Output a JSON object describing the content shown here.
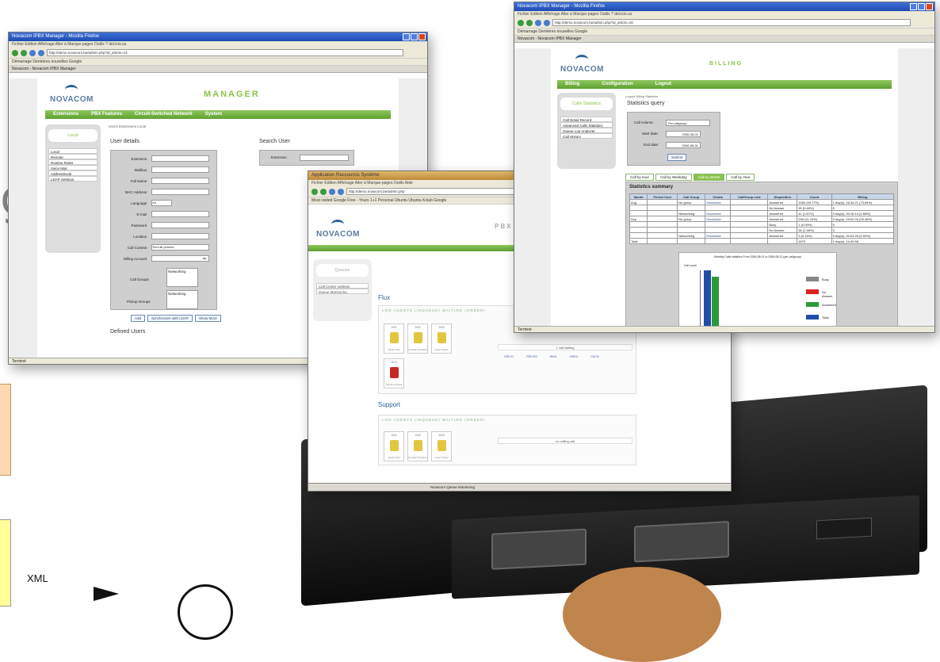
{
  "background": {
    "letter_left": "g",
    "xml_label": "XML"
  },
  "manager": {
    "title": "Novacom IPBX Manager - Mozilla Firefox",
    "menu": "Fichier  Edition  Affichage  Aller à  Marque-pages  Outils  ?  del.icio.us",
    "url": "http://demo.novacom.be/admin.php?id_article=13",
    "bookmarks": "Démarrage  Dernières nouvelles  Google",
    "tab": "Novacom - Novacom IPBX Manager",
    "logo": "NOVACOM",
    "app_title": "MANAGER",
    "nav": [
      "Extensions",
      "PBX Features",
      "Circuit-Switched Network",
      "System"
    ],
    "sidebar_header": "Local",
    "sidebar_items": [
      "Local",
      "Remote",
      "Routing Rules",
      "Voice Mail",
      "Addressbook",
      "LDAP Settings"
    ],
    "breadcrumb": "Users  Extensions  Local",
    "user_details_title": "User details",
    "fields": [
      "Extension",
      "Mailbox",
      "Full Name",
      "MAC Address",
      "Language",
      "E-mail",
      "Password",
      "Location",
      "Call Context",
      "Billing Account"
    ],
    "language_value": "en",
    "call_context_value": "Sort-all phones",
    "billing_account_value": "sip",
    "call_groups_label": "Call Groups",
    "call_groups_value": "Networking",
    "pickup_groups_label": "Pickup Groups",
    "pickup_groups_value": "Networking",
    "buttons": [
      "Add",
      "Synchronize with LDAP",
      "Show More"
    ],
    "search_title": "Search User",
    "search_field": "Extension",
    "defined_users": "Defined Users",
    "status": "Terminé"
  },
  "billing": {
    "title": "Novacom IPBX Manager - Mozilla Firefox",
    "menu": "Fichier  Edition  Affichage  Aller à  Marque-pages  Outils  ?  del.icio.us",
    "url": "http://demo.novacom.be/admin.php?id_article=18",
    "bookmarks": "Démarrage  Dernières nouvelles  Google",
    "tab": "Novacom - Novacom IPBX Manager",
    "logo": "NOVACOM",
    "app_title": "BILLING",
    "nav": [
      "Billing",
      "Configuration",
      "Logout"
    ],
    "sidebar_header": "Calls Statistics",
    "sidebar_items": [
      "Call Detail Record",
      "Advanced Calls Statistics",
      "Queue Log Analyzer",
      "Call History"
    ],
    "breadcrumb": "Logout  Billing  Statistics",
    "query_title": "Statistics query",
    "call_volume_label": "Call volume:",
    "call_volume_value": "Per callgroup",
    "start_label": "Start date:",
    "start_value": "2006-08-01",
    "end_label": "End date:",
    "end_value": "2006-08-31",
    "submit": "Submit",
    "tabs": [
      "Call by hour",
      "Call by Weekday",
      "Call by Month",
      "Call by Year"
    ],
    "summary_title": "Statistics summary",
    "table_headers": [
      "Month",
      "Period Cost",
      "Call Group",
      "Charts",
      "CallGroup cost",
      "Disposition",
      "Count",
      "Billing"
    ],
    "table_rows": [
      [
        "Aug",
        "",
        "No group",
        "Show/hide",
        "",
        "Answered",
        "1080 (99.77%)",
        "1 day(s), 16:34:21 (73.84%)"
      ],
      [
        "",
        "",
        "",
        "",
        "",
        "No Answer",
        "99 (0.48%)",
        "0"
      ],
      [
        "",
        "",
        "Networking",
        "Show/hide",
        "",
        "Answered",
        "41 (1.87%)",
        "0 day(s), 00:16:14 (0.68%)"
      ],
      [
        "Sep",
        "",
        "No group",
        "Show/hide",
        "",
        "Answered",
        "236 (21.24%)",
        "0 day(s), 09:52:04 (25.46%)"
      ],
      [
        "",
        "",
        "",
        "",
        "",
        "Busy",
        "1 (0.09%)",
        "0"
      ],
      [
        "",
        "",
        "",
        "",
        "",
        "No Answer",
        "38 (2.48%)",
        "0"
      ],
      [
        "",
        "",
        "Networking",
        "Show/hide",
        "",
        "Answered",
        "3 (0.19%)",
        "0 day(s), 00:03:25 (0.00%)"
      ],
      [
        "Total",
        "",
        "",
        "",
        "",
        "",
        "1679",
        "1 day(s), 14:40:58"
      ]
    ],
    "chart_title": "Monthly Calls statistics From 2006-08-01 to 2006-08-31 (per callgroup)",
    "chart_ylabel": "Call count",
    "legend": [
      "Busy",
      "No Answer",
      "Answered",
      "Total"
    ],
    "legend_colors": [
      "#888888",
      "#dd2222",
      "#2a9a3a",
      "#1f4ea8"
    ],
    "status": "Terminé"
  },
  "queues": {
    "title": "Application  Raccourcis  Système",
    "menu": "Fichier  Édition  Affichage  Aller à  Marque-pages  Outils  Aide",
    "url": "http://demo.novacom.be/admin.php",
    "bookmarks": "Most visited  Google Free - Yours  1+1 Personal  Ubuntu  Ubuntu  Kolab  Google",
    "logo": "NOVACOM",
    "app_title": "PBX",
    "side_header": "Queues",
    "side_items": [
      "Call Center settings",
      "Queue Monitoring"
    ],
    "group1": "Flux",
    "group1_header": "LOG AGENTS  (INQUEUE)  WAITING  (ORDER)",
    "group1_phones": [
      {
        "num": "1001",
        "label": "Ascan Test"
      },
      {
        "num": "1002",
        "label": "Compan Novacom"
      },
      {
        "num": "1003",
        "label": "Lionel Chaux"
      },
      {
        "num": "1010",
        "label": "Service Accueil"
      }
    ],
    "group1_waiting": "1 call waiting",
    "group1_stats": [
      "CBE 01",
      "FEB 002",
      "RING",
      "VIDEO",
      "CM 03"
    ],
    "group2": "Support",
    "group2_header": "LOG AGENTS  (INQUEUE)  WAITING  (ORDER)",
    "group2_phones": [
      {
        "num": "1001",
        "label": "Ascan Test"
      },
      {
        "num": "1002",
        "label": "Compan Novacom"
      },
      {
        "num": "1003",
        "label": "Lionel Chaux"
      }
    ],
    "group2_waiting": "no calling call",
    "taskbar": "Novacom Queue Monitoring"
  },
  "chart_data": {
    "type": "bar",
    "title": "Monthly Calls statistics From 2006-08-01 to 2006-08-31 (per callgroup)",
    "ylabel": "Call count",
    "categories": [
      "No group",
      "Networking"
    ],
    "series": [
      {
        "name": "Total",
        "values": [
          1180,
          44
        ]
      },
      {
        "name": "Answered",
        "values": [
          1080,
          41
        ]
      }
    ],
    "ylim": [
      0,
      1200
    ]
  }
}
